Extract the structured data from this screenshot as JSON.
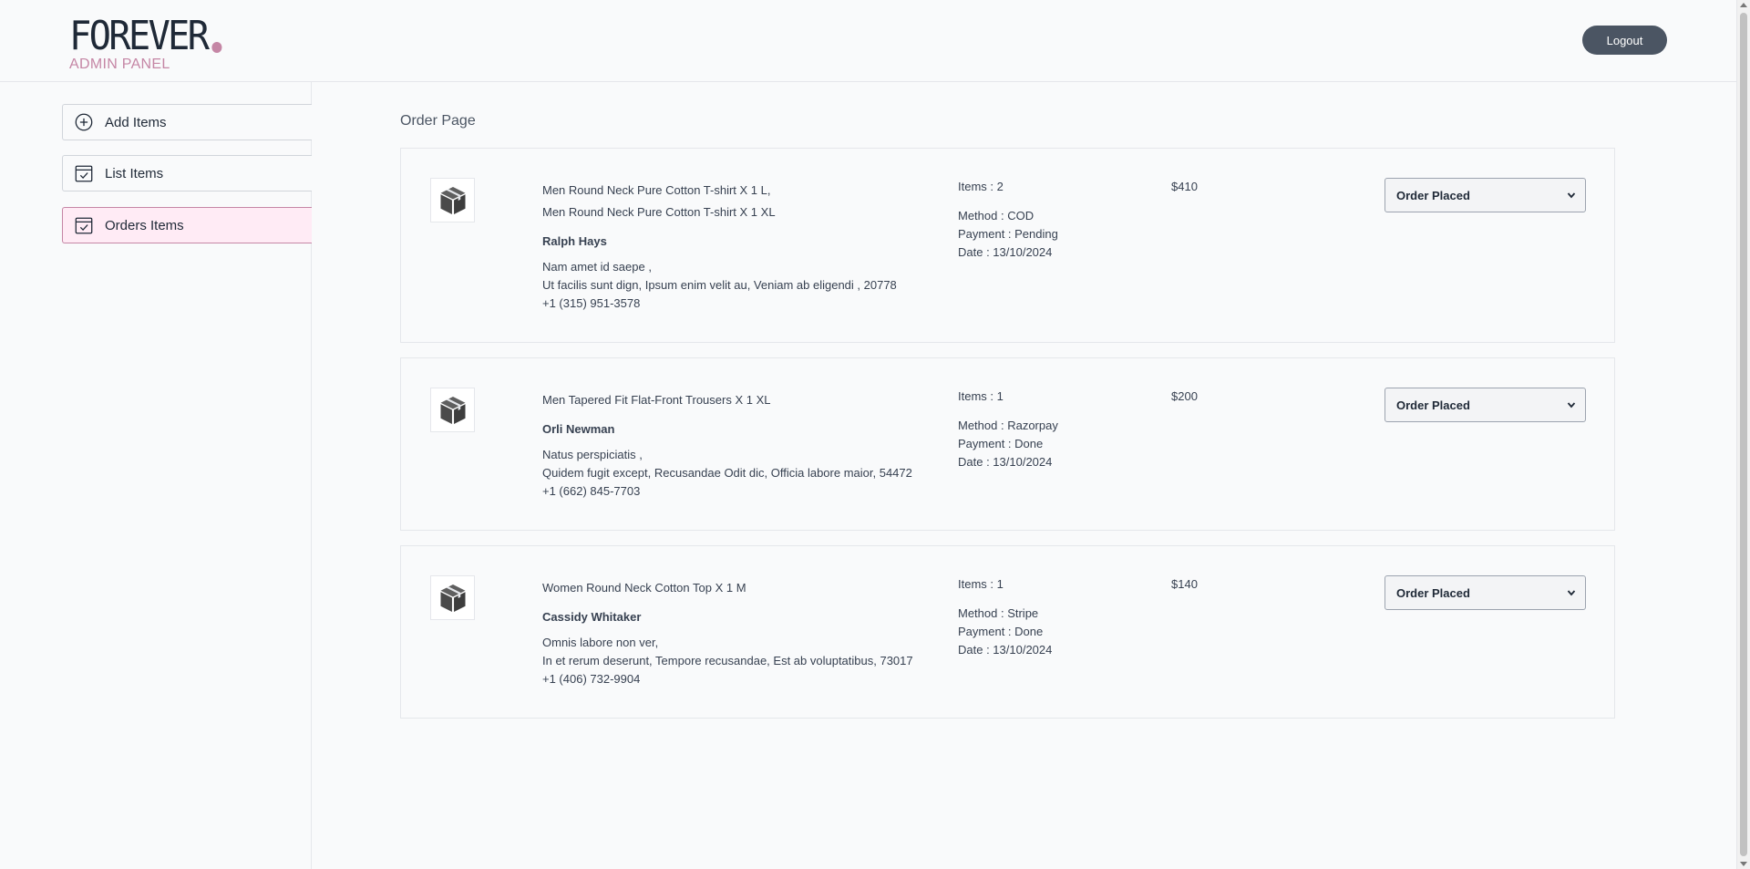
{
  "header": {
    "logo_text": "FOREVER",
    "logo_subtitle": "ADMIN PANEL",
    "logout_label": "Logout",
    "accent_color": "#c586a5"
  },
  "sidebar": {
    "items": [
      {
        "label": "Add Items",
        "icon": "add-circle-icon",
        "active": false
      },
      {
        "label": "List Items",
        "icon": "calendar-check-icon",
        "active": false
      },
      {
        "label": "Orders Items",
        "icon": "calendar-check-icon",
        "active": true
      }
    ]
  },
  "main": {
    "title": "Order Page",
    "orders": [
      {
        "icon": "parcel-icon",
        "items": [
          "Men Round Neck Pure Cotton T-shirt X 1 L,",
          "Men Round Neck Pure Cotton T-shirt X 1 XL"
        ],
        "customer": "Ralph Hays",
        "address_line1": "Nam amet id saepe ,",
        "address_line2": "Ut facilis sunt dign, Ipsum enim velit au, Veniam ab eligendi , 20778",
        "phone": "+1 (315) 951-3578",
        "items_count": "Items : 2",
        "method": "Method : COD",
        "payment": "Payment : Pending",
        "date": "Date : 13/10/2024",
        "amount": "$410",
        "status": "Order Placed"
      },
      {
        "icon": "parcel-icon",
        "items": [
          "Men Tapered Fit Flat-Front Trousers X 1 XL"
        ],
        "customer": "Orli Newman",
        "address_line1": "Natus perspiciatis ,",
        "address_line2": "Quidem fugit except, Recusandae Odit dic, Officia labore maior, 54472",
        "phone": "+1 (662) 845-7703",
        "items_count": "Items : 1",
        "method": "Method : Razorpay",
        "payment": "Payment : Done",
        "date": "Date : 13/10/2024",
        "amount": "$200",
        "status": "Order Placed"
      },
      {
        "icon": "parcel-icon",
        "items": [
          "Women Round Neck Cotton Top X 1 M"
        ],
        "customer": "Cassidy Whitaker",
        "address_line1": "Omnis labore non ver,",
        "address_line2": "In et rerum deserunt, Tempore recusandae, Est ab voluptatibus, 73017",
        "phone": "+1 (406) 732-9904",
        "items_count": "Items : 1",
        "method": "Method : Stripe",
        "payment": "Payment : Done",
        "date": "Date : 13/10/2024",
        "amount": "$140",
        "status": "Order Placed"
      }
    ]
  }
}
